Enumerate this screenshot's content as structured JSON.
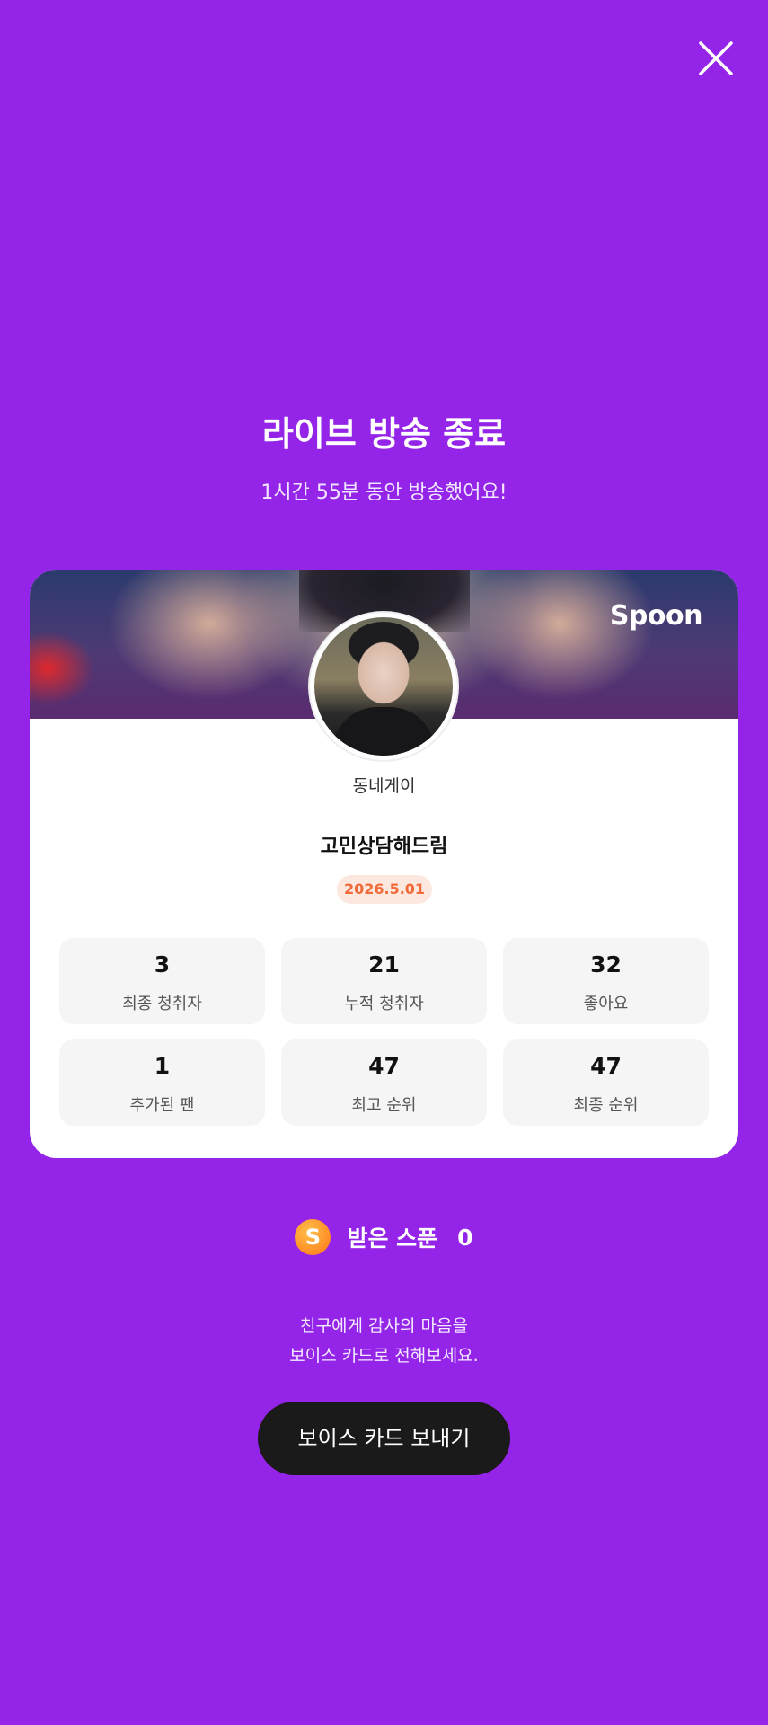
{
  "header": {
    "close_icon": "close-icon",
    "title": "라이브 방송 종료",
    "subtitle": "1시간 55분 동안 방송했어요!"
  },
  "card": {
    "brand": "Spoon",
    "username": "동네게이",
    "room_title": "고민상담해드림",
    "date": "2026.5.01",
    "stats": [
      {
        "value": "3",
        "label": "최종 청취자"
      },
      {
        "value": "21",
        "label": "누적 청취자"
      },
      {
        "value": "32",
        "label": "좋아요"
      },
      {
        "value": "1",
        "label": "추가된 팬"
      },
      {
        "value": "47",
        "label": "최고 순위"
      },
      {
        "value": "47",
        "label": "최종 순위"
      }
    ]
  },
  "spoons": {
    "coin_glyph": "S",
    "label": "받은 스푼",
    "count": "0"
  },
  "message": {
    "line1": "친구에게 감사의 마음을",
    "line2": "보이스 카드로 전해보세요."
  },
  "actions": {
    "send_voice_card": "보이스 카드 보내기"
  },
  "colors": {
    "background": "#9424e8",
    "button": "#1a1a1a",
    "date_badge_bg": "#fde8e0",
    "date_badge_text": "#f06a3a"
  }
}
